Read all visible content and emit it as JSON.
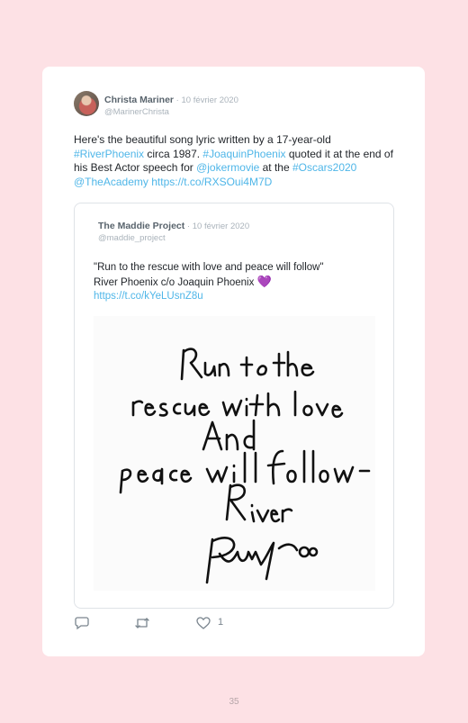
{
  "tweet": {
    "author_name": "Christa Mariner",
    "separator": " · ",
    "date": "10 février 2020",
    "handle": "@MarinerChrista",
    "text_parts": {
      "p1": "Here's the beautiful song lyric written by a 17-year-old ",
      "tag1": "#RiverPhoenix",
      "p2": " circa 1987. ",
      "tag2": "#JoaquinPhoenix",
      "p3": " quoted it at the end of his Best Actor speech for ",
      "mention1": "@jokermovie",
      "p4": " at the ",
      "tag3": "#Oscars2020",
      "p5": " ",
      "mention2": "@TheAcademy",
      "p6": " ",
      "url": "https://t.co/RXSOui4M7D"
    },
    "reply_count": "1",
    "colors": {
      "link": "#4fb6e8",
      "background": "#fde1e5"
    }
  },
  "quoted": {
    "author_name": "The Maddie Project",
    "separator": " · ",
    "date": "10 février 2020",
    "handle": "@maddie_project",
    "line1": "\"Run to the rescue with love and peace will follow\"",
    "line2": "River Phoenix c/o Joaquin Phoenix ",
    "emoji": "💜",
    "url": "https://t.co/kYeLUsnZ8u",
    "image_text": "Run to the rescue with love And peace will follow — River Phoenix"
  },
  "icons": [
    "reply-icon",
    "retweet-icon",
    "like-icon"
  ],
  "page_number": "35"
}
